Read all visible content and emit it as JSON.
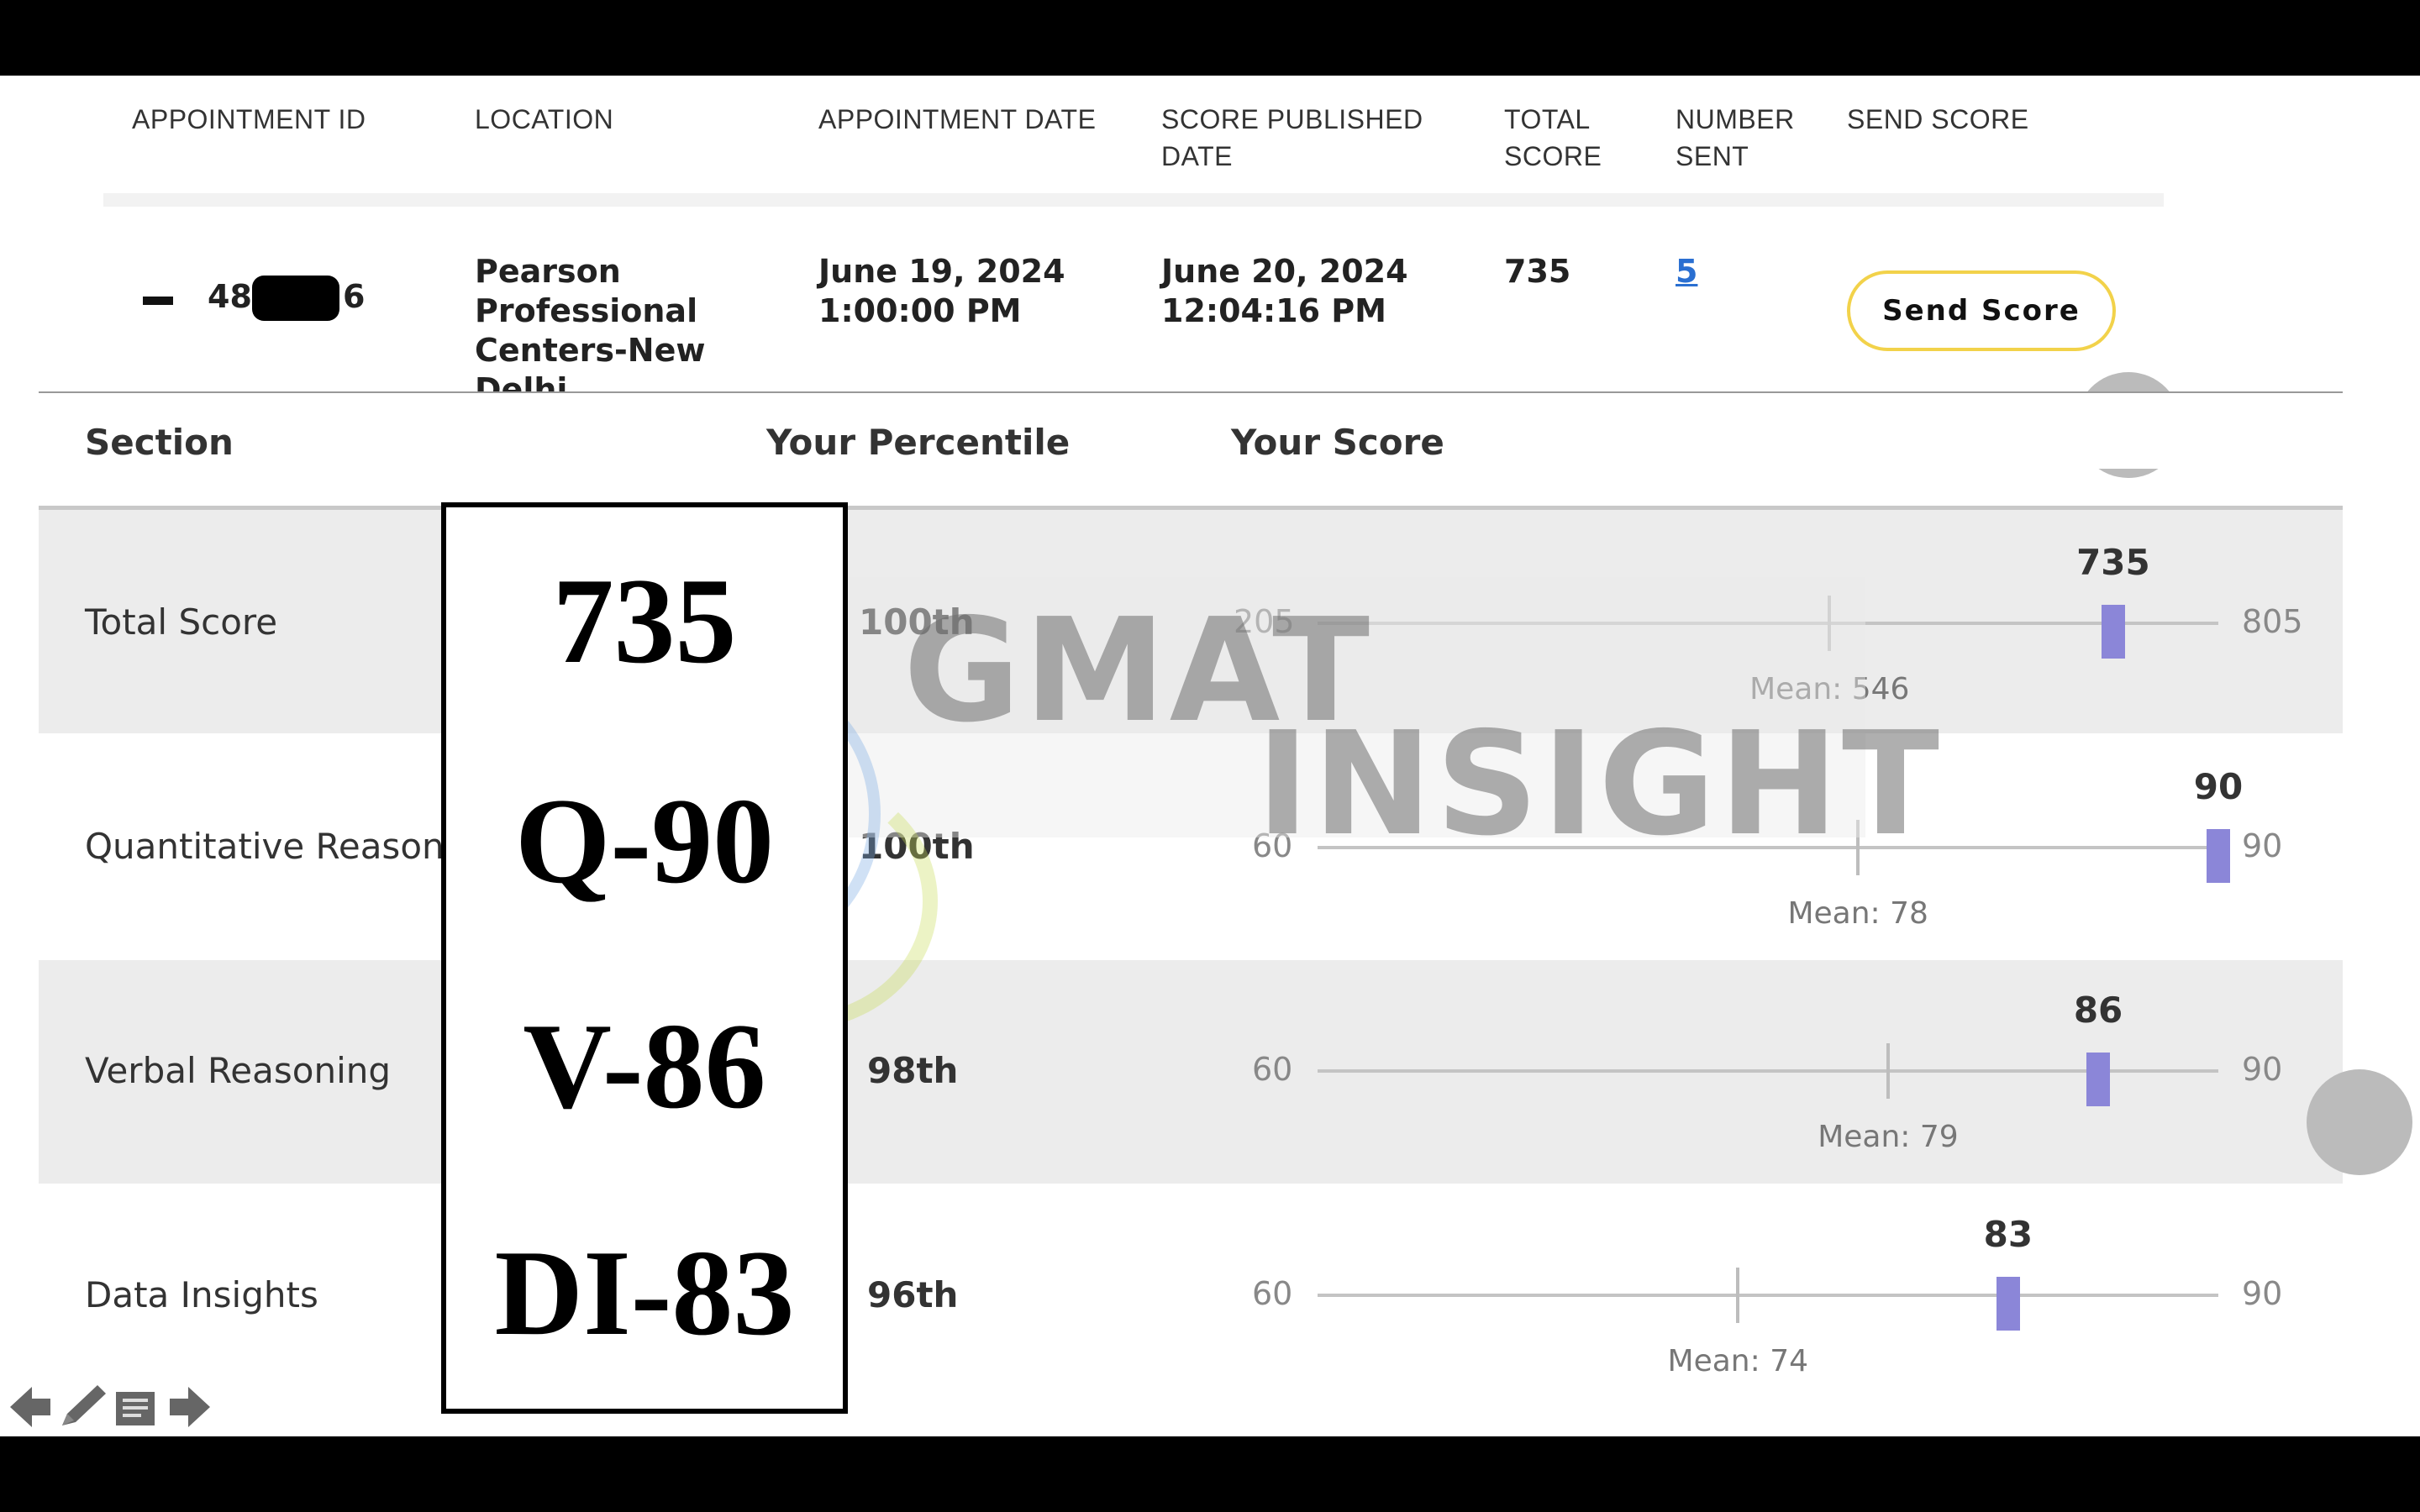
{
  "appointment_table": {
    "headers": {
      "appointment_id": "APPOINTMENT ID",
      "location": "LOCATION",
      "appointment_date": "APPOINTMENT DATE",
      "score_published_line1": "SCORE PUBLISHED",
      "score_published_line2": "DATE",
      "total_score_line1": "TOTAL",
      "total_score_line2": "SCORE",
      "number_sent_line1": "NUMBER",
      "number_sent_line2": "SENT",
      "send_score": "SEND SCORE"
    },
    "row": {
      "id_prefix": "48",
      "id_suffix": "6",
      "location_lines": [
        "Pearson",
        "Professional",
        "Centers-New",
        "Delhi"
      ],
      "appointment_date_line1": "June 19, 2024",
      "appointment_date_line2": "1:00:00 PM",
      "published_date_line1": "June 20, 2024",
      "published_date_line2": "12:04:16 PM",
      "total_score": "735",
      "number_sent": "5",
      "send_score_button": "Send Score"
    }
  },
  "score_table": {
    "headers": {
      "section": "Section",
      "percentile": "Your Percentile",
      "score": "Your Score"
    },
    "rows": [
      {
        "section": "Total Score",
        "percentile": "100th",
        "min": "205",
        "max": "805",
        "score": "735",
        "mean_label": "Mean: 546",
        "score_value": 735,
        "mean_value": 546,
        "range": [
          205,
          805
        ]
      },
      {
        "section": "Quantitative Reasoning",
        "percentile": "100th",
        "min": "60",
        "max": "90",
        "score": "90",
        "mean_label": "Mean: 78",
        "score_value": 90,
        "mean_value": 78,
        "range": [
          60,
          90
        ]
      },
      {
        "section": "Verbal Reasoning",
        "percentile": "98th",
        "min": "60",
        "max": "90",
        "score": "86",
        "mean_label": "Mean: 79",
        "score_value": 86,
        "mean_value": 79,
        "range": [
          60,
          90
        ]
      },
      {
        "section": "Data Insights",
        "percentile": "96th",
        "min": "60",
        "max": "90",
        "score": "83",
        "mean_label": "Mean: 74",
        "score_value": 83,
        "mean_value": 74,
        "range": [
          60,
          90
        ]
      }
    ]
  },
  "watermark": {
    "line1": "GMAT",
    "line2": "INSIGHT"
  },
  "overlay": {
    "lines": [
      "735",
      "Q-90",
      "V-86",
      "DI-83"
    ]
  },
  "colors": {
    "marker": "#8b86d8",
    "send_button_border": "#f2d24a",
    "link": "#2a6fd1",
    "row_shade": "#ececec"
  },
  "nav_icons": [
    "arrow-left-icon",
    "pencil-icon",
    "notes-icon",
    "arrow-right-icon"
  ]
}
